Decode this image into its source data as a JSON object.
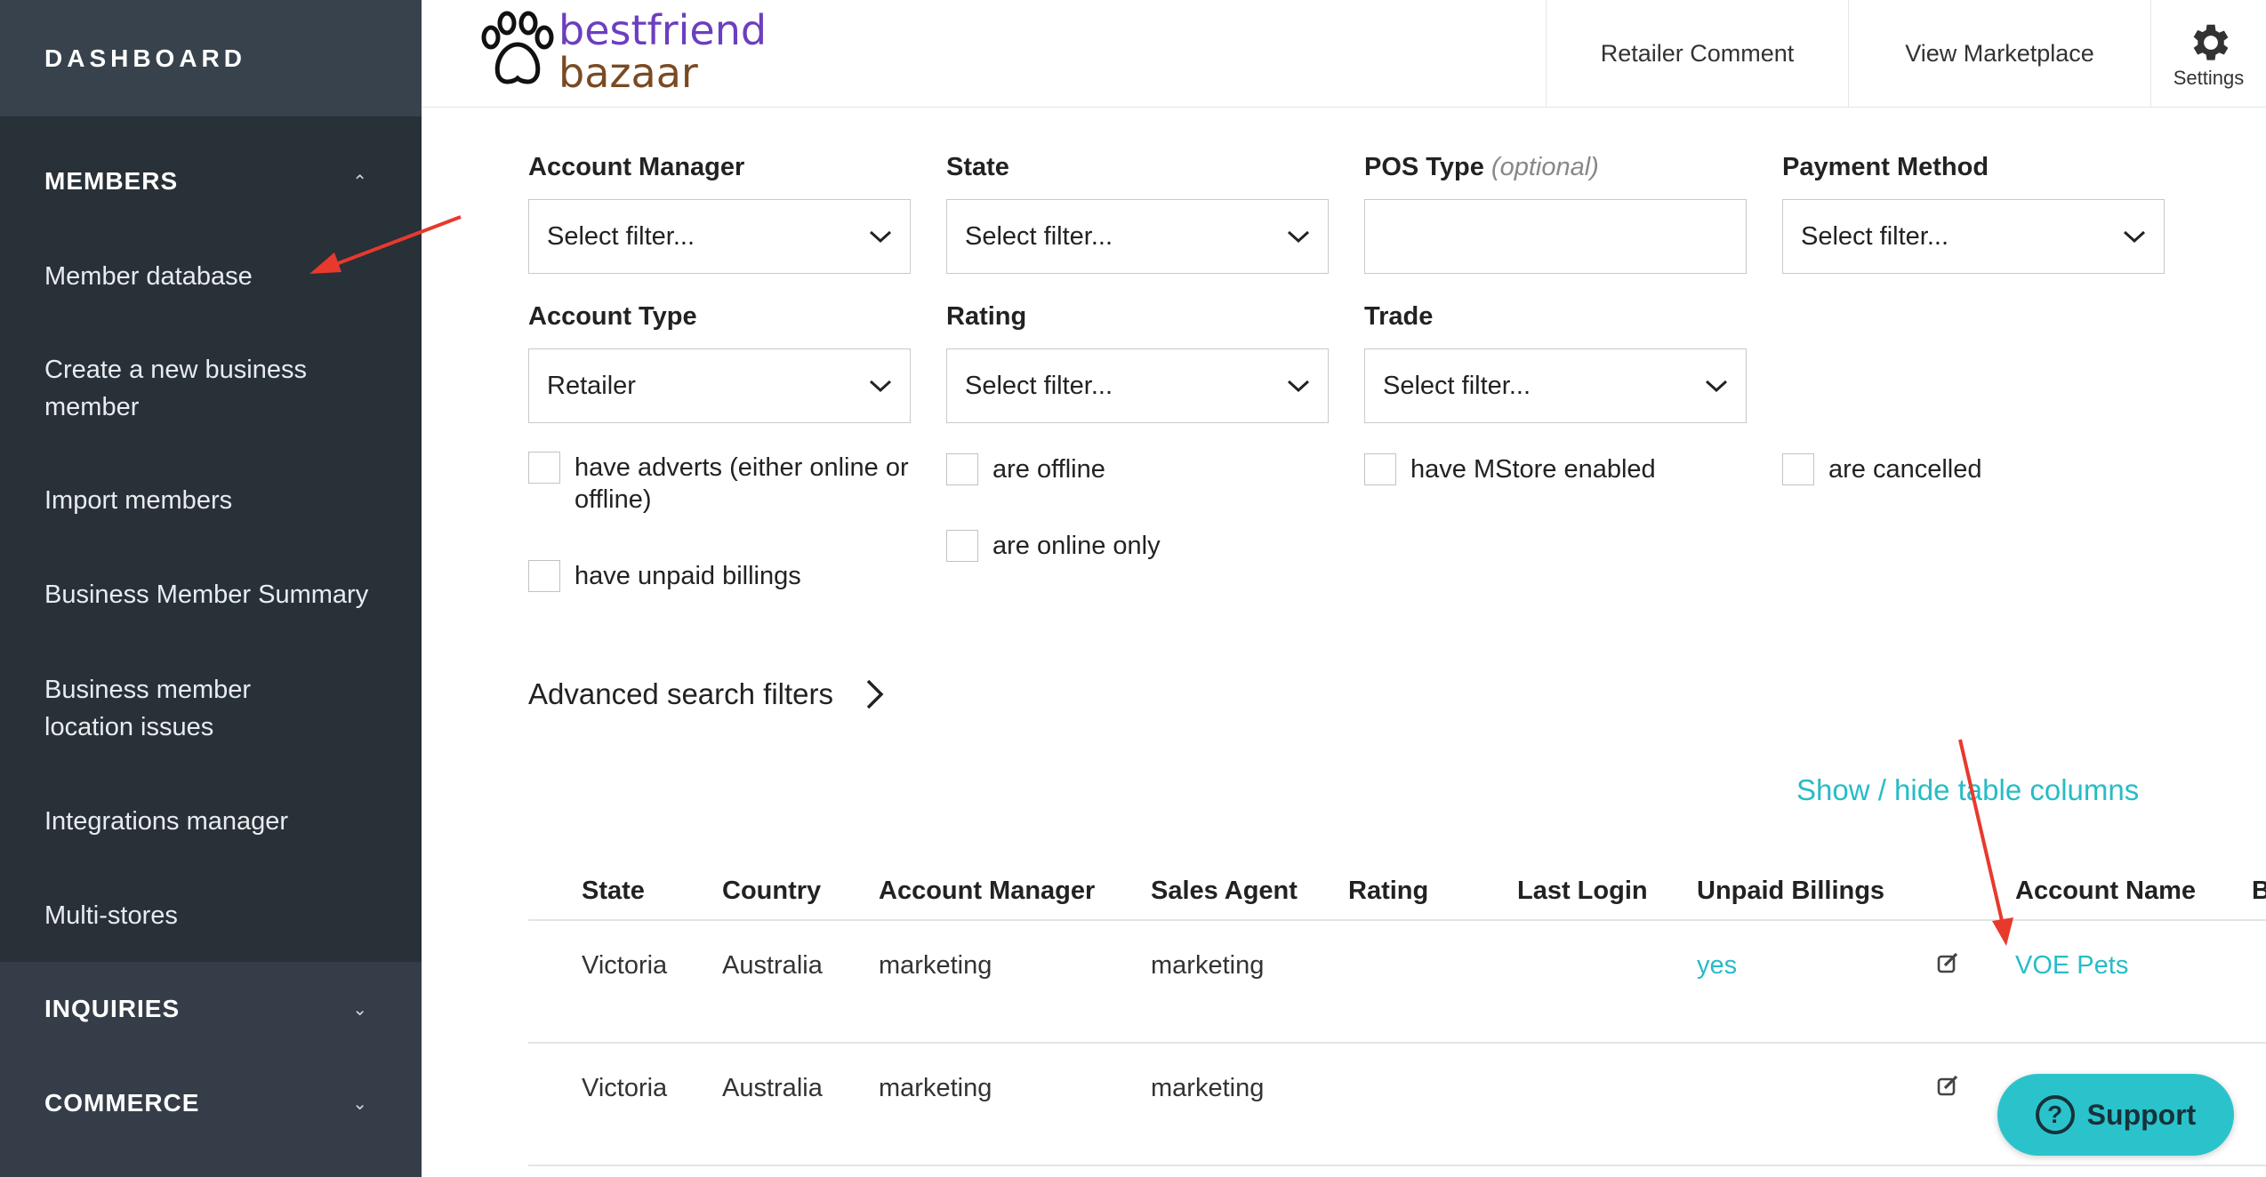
{
  "sidebar": {
    "dashboard": "DASHBOARD",
    "members_section": "MEMBERS",
    "items": [
      {
        "label": "Member database"
      },
      {
        "label": "Create a new business member"
      },
      {
        "label": "Import members"
      },
      {
        "label": "Business Member Summary"
      },
      {
        "label": "Business member location issues"
      },
      {
        "label": "Integrations manager"
      },
      {
        "label": "Multi-stores"
      }
    ],
    "inquiries_section": "INQUIRIES",
    "commerce_section": "COMMERCE"
  },
  "header": {
    "logo_line1": "bestfriend",
    "logo_line2": "bazaar",
    "retailer_comment": "Retailer Comment",
    "view_marketplace": "View Marketplace",
    "settings": "Settings"
  },
  "filters": {
    "account_manager": {
      "label": "Account Manager",
      "value": "Select filter..."
    },
    "state": {
      "label": "State",
      "value": "Select filter..."
    },
    "pos_type": {
      "label": "POS Type",
      "optional": "(optional)",
      "value": ""
    },
    "payment_method": {
      "label": "Payment Method",
      "value": "Select filter..."
    },
    "account_type": {
      "label": "Account Type",
      "value": "Retailer"
    },
    "rating": {
      "label": "Rating",
      "value": "Select filter..."
    },
    "trade": {
      "label": "Trade",
      "value": "Select filter..."
    },
    "checkboxes": {
      "have_adverts": "have adverts (either online or offline)",
      "have_unpaid": "have unpaid billings",
      "are_offline": "are offline",
      "are_online_only": "are online only",
      "have_mstore": "have MStore enabled",
      "are_cancelled": "are cancelled"
    }
  },
  "advanced_search": "Advanced search filters",
  "show_hide_columns": "Show / hide table columns",
  "table": {
    "headers": {
      "state": "State",
      "country": "Country",
      "account_manager": "Account Manager",
      "sales_agent": "Sales Agent",
      "rating": "Rating",
      "last_login": "Last Login",
      "unpaid_billings": "Unpaid Billings",
      "account_name": "Account Name",
      "b": "B"
    },
    "rows": [
      {
        "state": "Victoria",
        "country": "Australia",
        "account_manager": "marketing",
        "sales_agent": "marketing",
        "unpaid_billings": "yes",
        "account_name": "VOE Pets"
      },
      {
        "state": "Victoria",
        "country": "Australia",
        "account_manager": "marketing",
        "sales_agent": "marketing",
        "unpaid_billings": "",
        "account_name": ""
      }
    ]
  },
  "support": {
    "label": "Support",
    "icon": "?"
  },
  "colors": {
    "sidebar": "#283038",
    "accent": "#27bcc6",
    "annotation": "#e8392d"
  }
}
